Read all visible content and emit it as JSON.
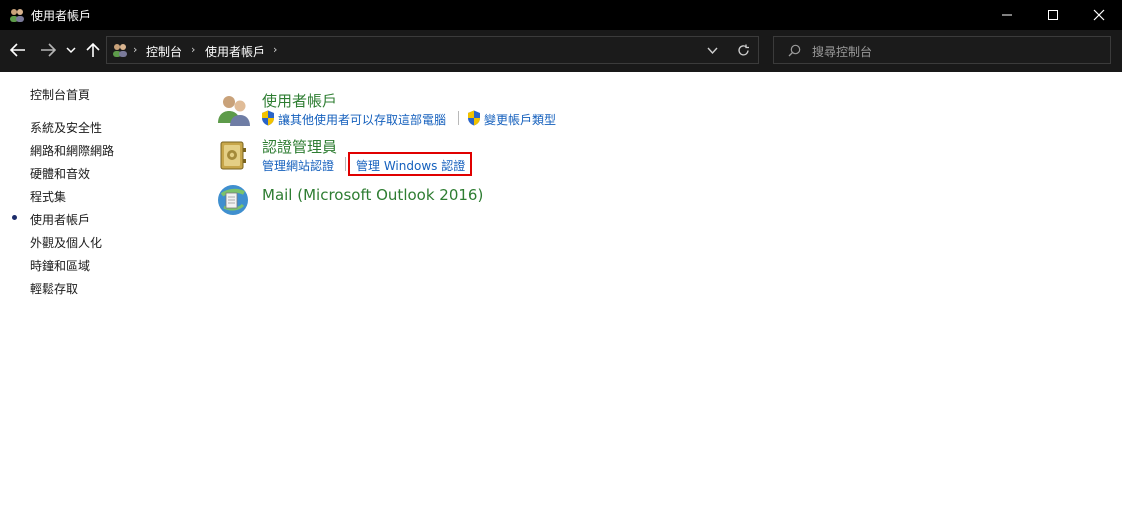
{
  "window": {
    "title": "使用者帳戶",
    "controls": {
      "minimize": "minimize-icon",
      "maximize": "maximize-icon",
      "close": "close-icon"
    }
  },
  "nav": {
    "breadcrumb": [
      "控制台",
      "使用者帳戶"
    ],
    "search_placeholder": "搜尋控制台"
  },
  "sidebar": {
    "home": "控制台首頁",
    "items": [
      {
        "label": "系統及安全性",
        "current": false
      },
      {
        "label": "網路和網際網路",
        "current": false
      },
      {
        "label": "硬體和音效",
        "current": false
      },
      {
        "label": "程式集",
        "current": false
      },
      {
        "label": "使用者帳戶",
        "current": true
      },
      {
        "label": "外觀及個人化",
        "current": false
      },
      {
        "label": "時鐘和區域",
        "current": false
      },
      {
        "label": "輕鬆存取",
        "current": false
      }
    ]
  },
  "main": {
    "sections": [
      {
        "title": "使用者帳戶",
        "links": [
          "讓其他使用者可以存取這部電腦",
          "變更帳戶類型"
        ]
      },
      {
        "title": "認證管理員",
        "links": [
          "管理網站認證",
          "管理 Windows 認證"
        ]
      },
      {
        "title": "Mail (Microsoft Outlook 2016)",
        "links": []
      }
    ]
  },
  "colors": {
    "heading_green": "#2e7d32",
    "link_blue": "#1560bd",
    "highlight_red": "#e00000"
  }
}
